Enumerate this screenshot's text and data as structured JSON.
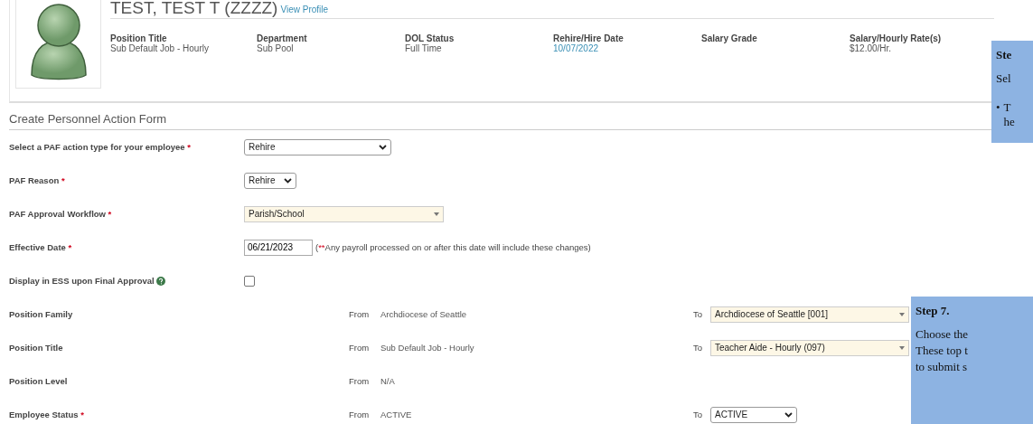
{
  "employee": {
    "name": "TEST, TEST T (ZZZZ)",
    "profile_link": "View Profile",
    "fields": [
      {
        "label": "Position Title",
        "value": "Sub Default Job - Hourly",
        "kind": "plain"
      },
      {
        "label": "Department",
        "value": "Sub Pool",
        "kind": "plain"
      },
      {
        "label": "DOL Status",
        "value": "Full Time",
        "kind": "plain"
      },
      {
        "label": "Rehire/Hire Date",
        "value": "10/07/2022",
        "kind": "link"
      },
      {
        "label": "Salary Grade"
      },
      {
        "label": "Salary/Hourly Rate(s)",
        "value": "$12.00/Hr.",
        "kind": "plain"
      }
    ]
  },
  "form": {
    "title": "Create Personnel Action Form",
    "rows": [
      {
        "kind": "wide_select",
        "label": "Select a PAF action type for your employee",
        "required_mark": "*",
        "value": "Rehire"
      },
      {
        "kind": "select",
        "label": "PAF Reason",
        "required_mark": "*",
        "value": "Rehire"
      },
      {
        "kind": "combo",
        "label": "PAF Approval Workflow",
        "required_mark": "*",
        "value": "Parish/School"
      },
      {
        "kind": "date",
        "label": "Effective Date",
        "required_mark": "*",
        "value": "06/21/2023",
        "note_open": "(",
        "note_mark": "**",
        "note": "Any payroll processed on or after this date will include these changes)"
      },
      {
        "kind": "checkbox",
        "label": "Display in ESS upon Final Approval",
        "checked": false
      }
    ],
    "changes": [
      {
        "label": "Position Family",
        "from_label": "From",
        "from": "Archdiocese of Seattle",
        "to": {
          "label": "To",
          "value": "Archdiocese of Seattle [001]",
          "kind": "combo"
        }
      },
      {
        "label": "Position Title",
        "from_label": "From",
        "from": "Sub Default Job - Hourly",
        "to": {
          "label": "To",
          "value": "Teacher Aide - Hourly (097)",
          "kind": "combo"
        }
      },
      {
        "label": "Position Level",
        "from_label": "From",
        "from": "N/A"
      },
      {
        "label": "Employee Status",
        "required_mark": "*",
        "from_label": "From",
        "from": "ACTIVE",
        "to": {
          "label": "To",
          "value": "ACTIVE",
          "kind": "select"
        }
      }
    ]
  },
  "callouts": [
    {
      "title": "Ste",
      "lines": [
        "Sel"
      ],
      "bullet": "•",
      "bullet_lines": [
        "T",
        "he"
      ]
    },
    {
      "title": "Step 7.",
      "lines": [
        "Choose the",
        "These top t",
        "to submit s"
      ]
    }
  ]
}
